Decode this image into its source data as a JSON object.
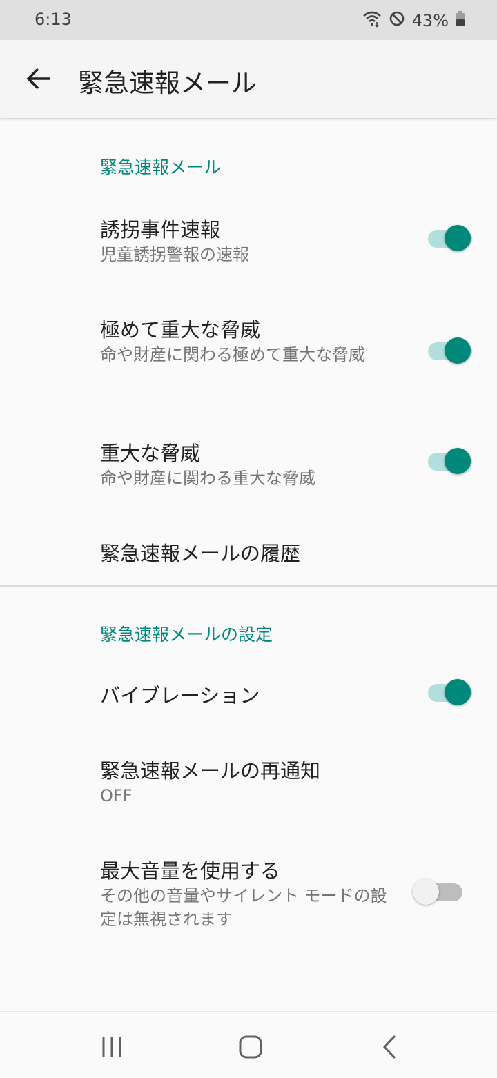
{
  "status": {
    "time": "6:13",
    "battery": "43%"
  },
  "app_bar": {
    "title": "緊急速報メール"
  },
  "sections": {
    "alerts_header": "緊急速報メール",
    "settings_header": "緊急速報メールの設定"
  },
  "items": {
    "amber": {
      "title": "誘拐事件速報",
      "summary": "児童誘拐警報の速報",
      "enabled": true
    },
    "extreme": {
      "title": "極めて重大な脅威",
      "summary": "命や財産に関わる極めて重大な脅威",
      "enabled": true
    },
    "severe": {
      "title": "重大な脅威",
      "summary": "命や財産に関わる重大な脅威",
      "enabled": true
    },
    "history": {
      "title": "緊急速報メールの履歴"
    },
    "vibration": {
      "title": "バイブレーション",
      "enabled": true
    },
    "reminder": {
      "title": "緊急速報メールの再通知",
      "summary": "OFF"
    },
    "full_volume": {
      "title": "最大音量を使用する",
      "summary": "その他の音量やサイレント モードの設定は無視されます",
      "enabled": false
    }
  },
  "colors": {
    "accent": "#00897b",
    "accent_track": "#b2dfdb",
    "status_bar": "#e0e0e0"
  },
  "icons": {
    "status": [
      "wifi-icon",
      "do-not-disturb-icon",
      "battery-icon"
    ],
    "navigation": [
      "back-arrow-icon",
      "recent-apps-icon",
      "home-icon",
      "back-icon"
    ]
  }
}
